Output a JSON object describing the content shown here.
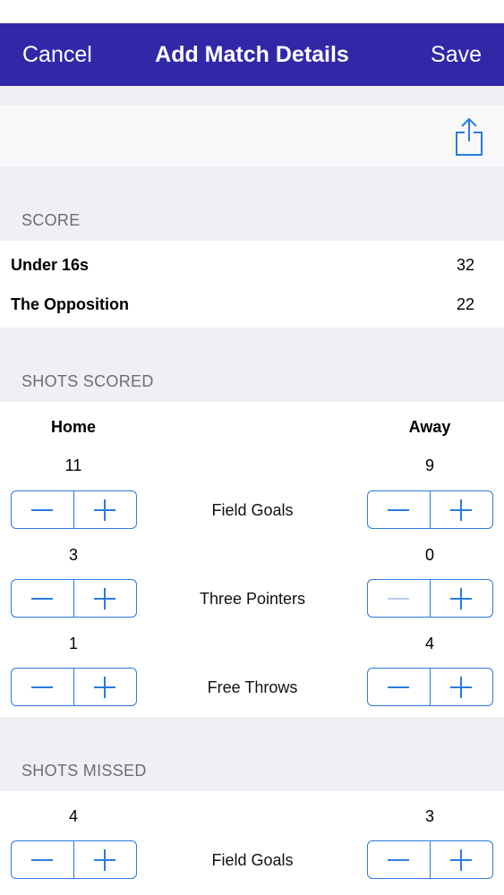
{
  "nav": {
    "cancel_label": "Cancel",
    "title": "Add Match Details",
    "save_label": "Save",
    "bar_color": "#3128a8"
  },
  "share": {
    "icon": "share-icon"
  },
  "score": {
    "header": "SCORE",
    "rows": [
      {
        "team": "Under 16s",
        "points": "32"
      },
      {
        "team": "The Opposition",
        "points": "22"
      }
    ]
  },
  "shots_scored": {
    "header": "SHOTS SCORED",
    "home_label": "Home",
    "away_label": "Away",
    "stats": [
      {
        "label": "Field Goals",
        "home": "11",
        "away": "9"
      },
      {
        "label": "Three Pointers",
        "home": "3",
        "away": "0"
      },
      {
        "label": "Free Throws",
        "home": "1",
        "away": "4"
      }
    ]
  },
  "shots_missed": {
    "header": "SHOTS MISSED",
    "stats": [
      {
        "label": "Field Goals",
        "home": "4",
        "away": "3"
      }
    ]
  },
  "accent_color": "#2a7be0"
}
